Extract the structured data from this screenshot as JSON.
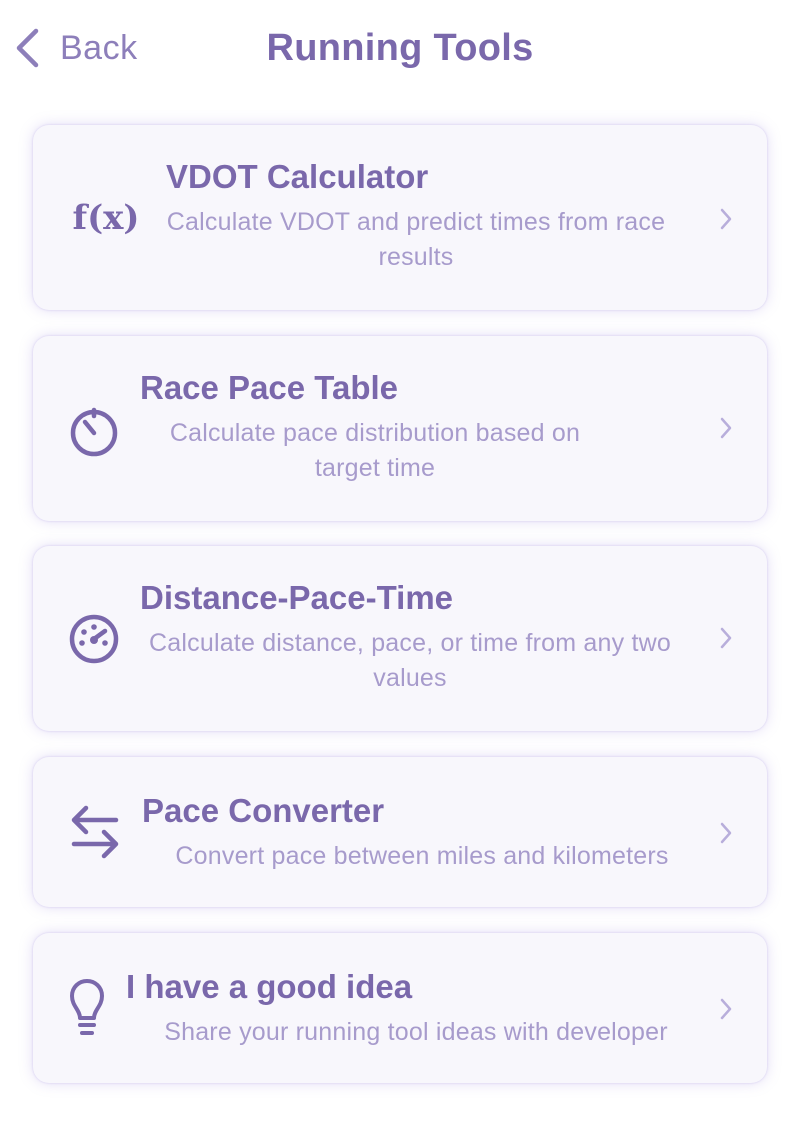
{
  "nav": {
    "back_label": "Back",
    "title": "Running Tools"
  },
  "tools": [
    {
      "icon": "function-icon",
      "title": "VDOT Calculator",
      "description": "Calculate VDOT and predict times from race results",
      "icon_glyph": "f(x)"
    },
    {
      "icon": "stopwatch-icon",
      "title": "Race Pace Table",
      "description": "Calculate pace distribution based on target time"
    },
    {
      "icon": "speedometer-icon",
      "title": "Distance-Pace-Time",
      "description": "Calculate distance, pace, or time from any two values"
    },
    {
      "icon": "swap-arrows-icon",
      "title": "Pace Converter",
      "description": "Convert pace between miles and kilometers"
    },
    {
      "icon": "lightbulb-icon",
      "title": "I have a good idea",
      "description": "Share your running tool ideas with developer"
    }
  ],
  "colors": {
    "accent": "#7a68ab",
    "secondary_text": "#a79bcc",
    "card_background": "#f8f7fc",
    "chevron": "#b8aedb"
  }
}
